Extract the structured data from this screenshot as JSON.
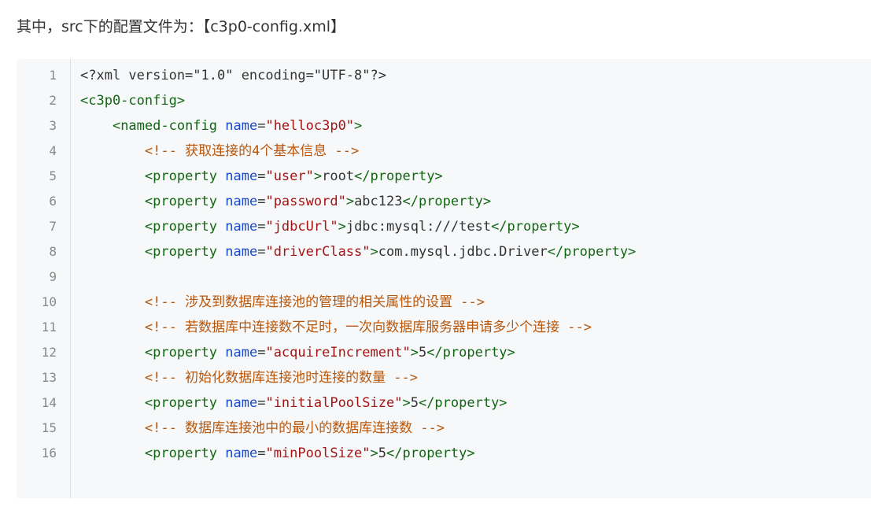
{
  "intro": "其中，src下的配置文件为：【c3p0-config.xml】",
  "code": {
    "line_numbers": [
      "1",
      "2",
      "3",
      "4",
      "5",
      "6",
      "7",
      "8",
      "9",
      "10",
      "11",
      "12",
      "13",
      "14",
      "15",
      "16"
    ],
    "lines": [
      [
        {
          "t": "text",
          "v": "<?xml version=\"1.0\" encoding=\"UTF-8\"?>"
        }
      ],
      [
        {
          "t": "tag",
          "v": "<c3p0-config>"
        }
      ],
      [
        {
          "t": "text",
          "v": "    "
        },
        {
          "t": "tag",
          "v": "<named-config "
        },
        {
          "t": "attr",
          "v": "name"
        },
        {
          "t": "text",
          "v": "="
        },
        {
          "t": "val",
          "v": "\"helloc3p0\""
        },
        {
          "t": "tag",
          "v": ">"
        }
      ],
      [
        {
          "t": "text",
          "v": "        "
        },
        {
          "t": "comment",
          "v": "<!-- 获取连接的4个基本信息 -->"
        }
      ],
      [
        {
          "t": "text",
          "v": "        "
        },
        {
          "t": "tag",
          "v": "<property "
        },
        {
          "t": "attr",
          "v": "name"
        },
        {
          "t": "text",
          "v": "="
        },
        {
          "t": "val",
          "v": "\"user\""
        },
        {
          "t": "tag",
          "v": ">"
        },
        {
          "t": "text",
          "v": "root"
        },
        {
          "t": "tag",
          "v": "</property>"
        }
      ],
      [
        {
          "t": "text",
          "v": "        "
        },
        {
          "t": "tag",
          "v": "<property "
        },
        {
          "t": "attr",
          "v": "name"
        },
        {
          "t": "text",
          "v": "="
        },
        {
          "t": "val",
          "v": "\"password\""
        },
        {
          "t": "tag",
          "v": ">"
        },
        {
          "t": "text",
          "v": "abc123"
        },
        {
          "t": "tag",
          "v": "</property>"
        }
      ],
      [
        {
          "t": "text",
          "v": "        "
        },
        {
          "t": "tag",
          "v": "<property "
        },
        {
          "t": "attr",
          "v": "name"
        },
        {
          "t": "text",
          "v": "="
        },
        {
          "t": "val",
          "v": "\"jdbcUrl\""
        },
        {
          "t": "tag",
          "v": ">"
        },
        {
          "t": "text",
          "v": "jdbc:mysql:///test"
        },
        {
          "t": "tag",
          "v": "</property>"
        }
      ],
      [
        {
          "t": "text",
          "v": "        "
        },
        {
          "t": "tag",
          "v": "<property "
        },
        {
          "t": "attr",
          "v": "name"
        },
        {
          "t": "text",
          "v": "="
        },
        {
          "t": "val",
          "v": "\"driverClass\""
        },
        {
          "t": "tag",
          "v": ">"
        },
        {
          "t": "text",
          "v": "com.mysql.jdbc.Driver"
        },
        {
          "t": "tag",
          "v": "</property>"
        }
      ],
      [],
      [
        {
          "t": "text",
          "v": "        "
        },
        {
          "t": "comment",
          "v": "<!-- 涉及到数据库连接池的管理的相关属性的设置 -->"
        }
      ],
      [
        {
          "t": "text",
          "v": "        "
        },
        {
          "t": "comment",
          "v": "<!-- 若数据库中连接数不足时，一次向数据库服务器申请多少个连接 -->"
        }
      ],
      [
        {
          "t": "text",
          "v": "        "
        },
        {
          "t": "tag",
          "v": "<property "
        },
        {
          "t": "attr",
          "v": "name"
        },
        {
          "t": "text",
          "v": "="
        },
        {
          "t": "val",
          "v": "\"acquireIncrement\""
        },
        {
          "t": "tag",
          "v": ">"
        },
        {
          "t": "text",
          "v": "5"
        },
        {
          "t": "tag",
          "v": "</property>"
        }
      ],
      [
        {
          "t": "text",
          "v": "        "
        },
        {
          "t": "comment",
          "v": "<!-- 初始化数据库连接池时连接的数量 -->"
        }
      ],
      [
        {
          "t": "text",
          "v": "        "
        },
        {
          "t": "tag",
          "v": "<property "
        },
        {
          "t": "attr",
          "v": "name"
        },
        {
          "t": "text",
          "v": "="
        },
        {
          "t": "val",
          "v": "\"initialPoolSize\""
        },
        {
          "t": "tag",
          "v": ">"
        },
        {
          "t": "text",
          "v": "5"
        },
        {
          "t": "tag",
          "v": "</property>"
        }
      ],
      [
        {
          "t": "text",
          "v": "        "
        },
        {
          "t": "comment",
          "v": "<!-- 数据库连接池中的最小的数据库连接数 -->"
        }
      ],
      [
        {
          "t": "text",
          "v": "        "
        },
        {
          "t": "tag",
          "v": "<property "
        },
        {
          "t": "attr",
          "v": "name"
        },
        {
          "t": "text",
          "v": "="
        },
        {
          "t": "val",
          "v": "\"minPoolSize\""
        },
        {
          "t": "tag",
          "v": ">"
        },
        {
          "t": "text",
          "v": "5"
        },
        {
          "t": "tag",
          "v": "</property>"
        }
      ]
    ]
  }
}
